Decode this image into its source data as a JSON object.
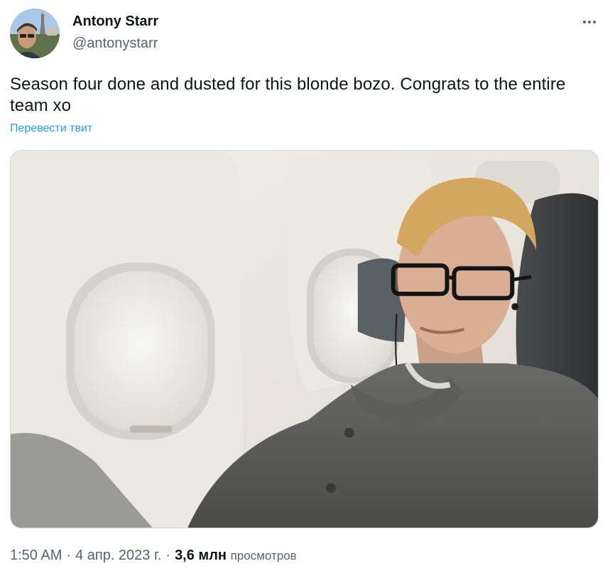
{
  "author": {
    "display_name": "Antony Starr",
    "handle": "@antonystarr"
  },
  "tweet": {
    "text": "Season four done and dusted for this blonde bozo. Congrats to the entire team xo",
    "translate_label": "Перевести твит"
  },
  "meta": {
    "time": "1:50 AM",
    "date": "4 апр. 2023 г.",
    "views_count": "3,6 млн",
    "views_label": "просмотров",
    "separator": "·"
  },
  "icons": {
    "more": "more-horizontal-icon"
  },
  "colors": {
    "text_primary": "#0f1419",
    "text_secondary": "#536471",
    "link": "#1d9bf0",
    "border": "#cfd9de"
  }
}
